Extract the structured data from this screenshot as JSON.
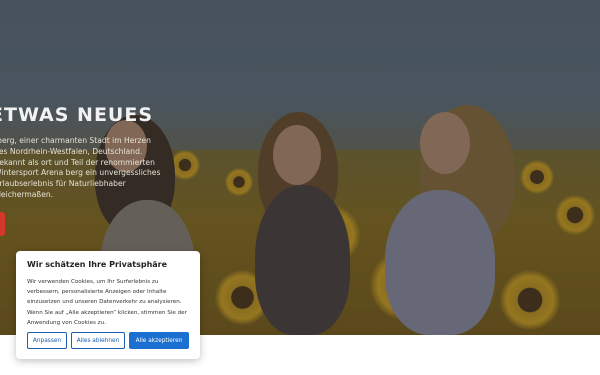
{
  "hero": {
    "title": "ETWAS NEUES",
    "text": "rberg, einer charmanten Stadt im Herzen des Nordrhein-Westfalen, Deutschland. Bekannt als ort und Teil der renommierten Wintersport Arena berg ein unvergessliches Urlaubserlebnis für Naturliebhaber gleichermaßen."
  },
  "cookie_banner": {
    "title": "Wir schätzen Ihre Privatsphäre",
    "text": "Wir verwenden Cookies, um Ihr Surferlebnis zu verbessern, personalisierte Anzeigen oder Inhalte einzusetzen und unseren Datenverkehr zu analysieren. Wenn Sie auf „Alle akzeptieren“ klicken, stimmen Sie der Anwendung von Cookies zu.",
    "buttons": {
      "customize": "Anpassen",
      "reject_all": "Alles ablehnen",
      "accept_all": "Alle akzeptieren"
    }
  },
  "colors": {
    "accent": "#1a6fd1",
    "red_tab": "#d6372b"
  }
}
